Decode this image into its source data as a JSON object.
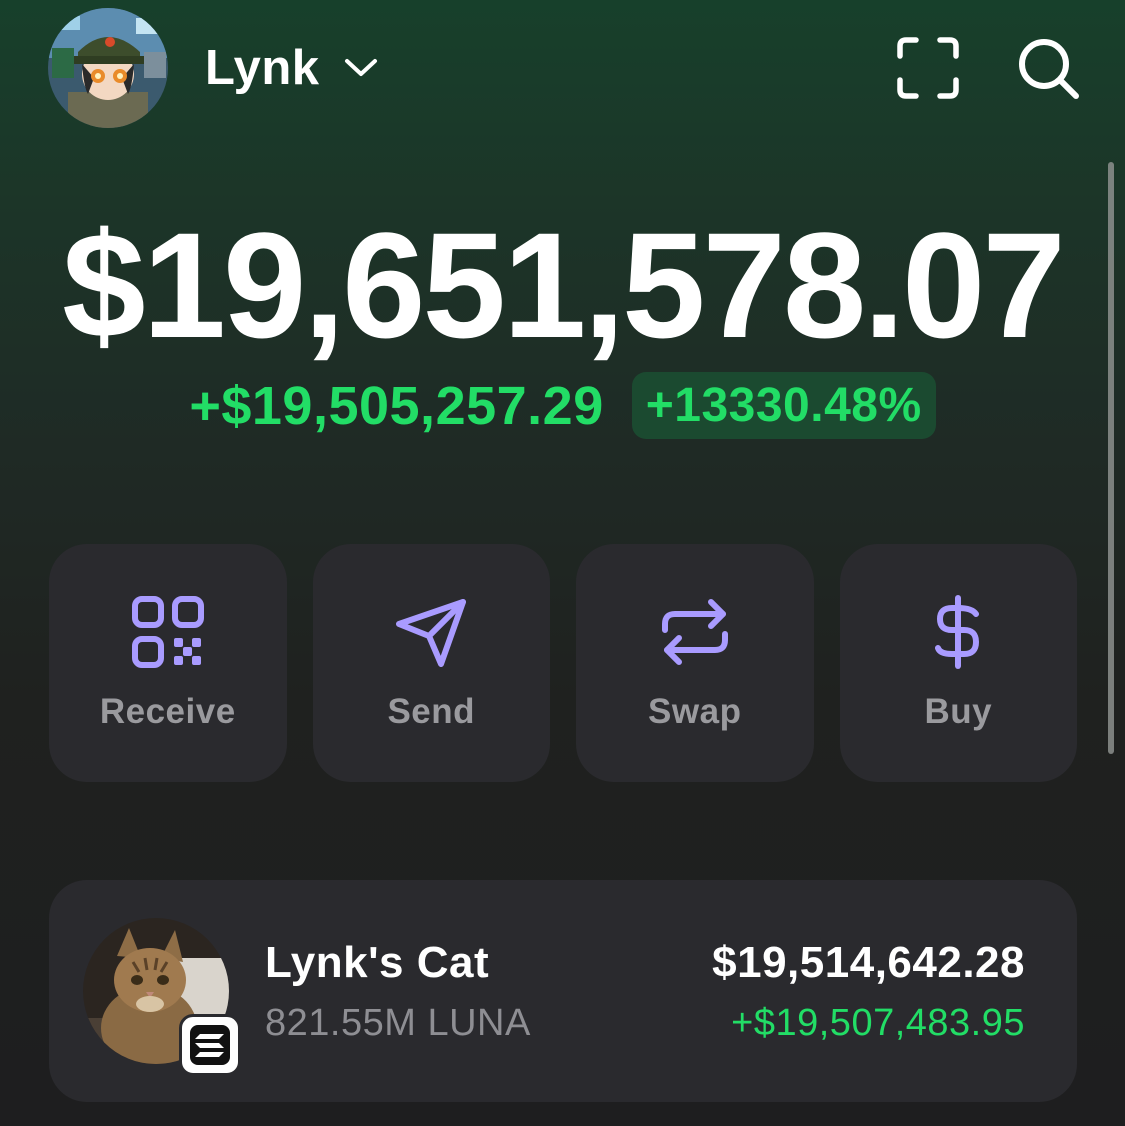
{
  "header": {
    "account_name": "Lynk",
    "icons": [
      "chevron-down-icon",
      "scan-icon",
      "search-icon"
    ]
  },
  "portfolio": {
    "balance": "$19,651,578.07",
    "change_amount": "+$19,505,257.29",
    "change_percent": "+13330.48%"
  },
  "actions": [
    {
      "label": "Receive",
      "icon": "qr-code-icon"
    },
    {
      "label": "Send",
      "icon": "send-icon"
    },
    {
      "label": "Swap",
      "icon": "swap-icon"
    },
    {
      "label": "Buy",
      "icon": "dollar-icon"
    }
  ],
  "tokens": [
    {
      "name": "Lynk's Cat",
      "amount": "821.55M LUNA",
      "value": "$19,514,642.28",
      "change": "+$19,507,483.95",
      "chain_icon": "solana-icon"
    }
  ],
  "colors": {
    "accent": "#a99bff",
    "positive": "#22dd66",
    "card": "#2a2a2e",
    "muted_text": "#9a9a9e"
  }
}
